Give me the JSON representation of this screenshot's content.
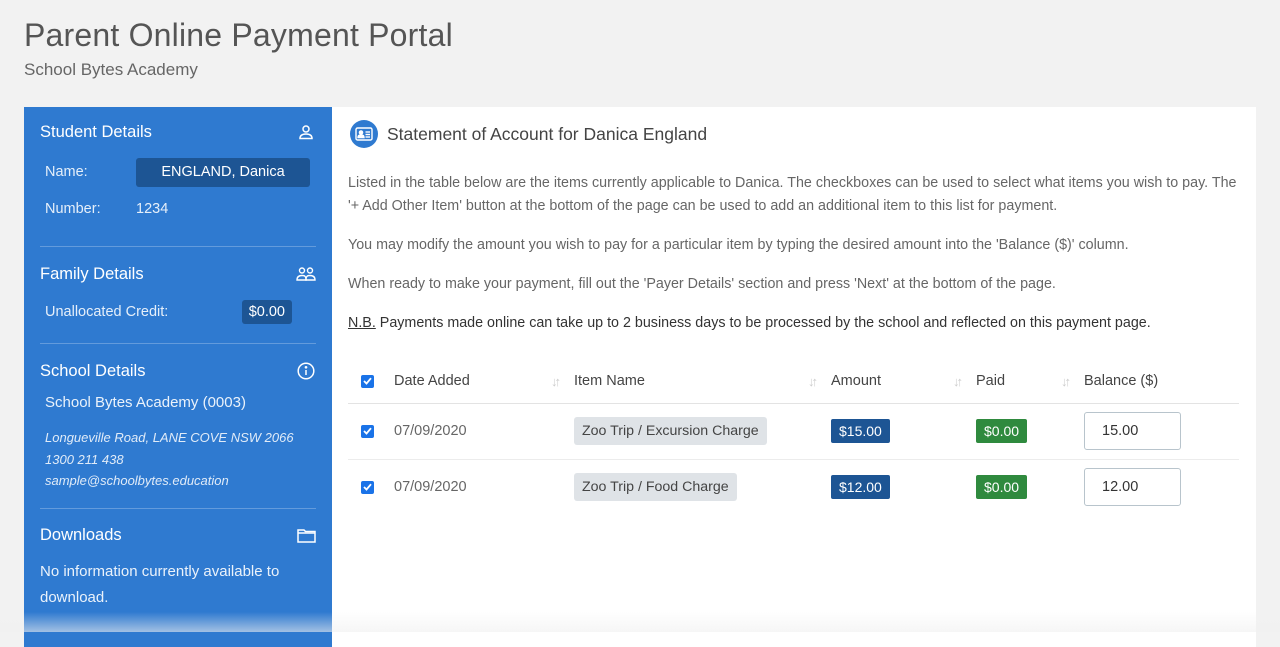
{
  "header": {
    "title": "Parent Online Payment Portal",
    "subtitle": "School Bytes Academy"
  },
  "sidebar": {
    "student": {
      "title": "Student Details",
      "icon": "user-icon",
      "name_label": "Name:",
      "name_value": "ENGLAND, Danica",
      "number_label": "Number:",
      "number_value": "1234"
    },
    "family": {
      "title": "Family Details",
      "icon": "users-icon",
      "credit_label": "Unallocated Credit:",
      "credit_value": "$0.00"
    },
    "school": {
      "title": "School Details",
      "icon": "info-icon",
      "name": "School Bytes Academy (0003)",
      "address": "Longueville Road, LANE COVE NSW 2066",
      "phone": "1300 211 438",
      "email": "sample@schoolbytes.education"
    },
    "downloads": {
      "title": "Downloads",
      "icon": "folder-icon",
      "text": "No information currently available to download."
    }
  },
  "main": {
    "title": "Statement of Account for Danica England",
    "icon": "id-card-icon",
    "intro": "Listed in the table below are the items currently applicable to Danica. The checkboxes can be used to select what items you wish to pay. The '+ Add Other Item' button at the bottom of the page can be used to add an additional item to this list for payment.",
    "modify": "You may modify the amount you wish to pay for a particular item by typing the desired amount into the 'Balance ($)' column.",
    "ready": "When ready to make your payment, fill out the 'Payer Details' section and press 'Next' at the bottom of the page.",
    "nb_label": "N.B.",
    "nb_text": " Payments made online can take up to 2 business days to be processed by the school and reflected on this payment page.",
    "table": {
      "select_all_checked": true,
      "columns": [
        "Date Added",
        "Item Name",
        "Amount",
        "Paid",
        "Balance ($)"
      ],
      "rows": [
        {
          "checked": true,
          "date": "07/09/2020",
          "item": "Zoo Trip / Excursion Charge",
          "amount": "$15.00",
          "paid": "$0.00",
          "balance": "15.00"
        },
        {
          "checked": true,
          "date": "07/09/2020",
          "item": "Zoo Trip / Food Charge",
          "amount": "$12.00",
          "paid": "$0.00",
          "balance": "12.00"
        }
      ]
    }
  },
  "colors": {
    "sidebar_bg": "#2f7ad0",
    "pill_dark_blue": "#1d5594",
    "paid_green": "#2f8a3e",
    "checkbox_blue": "#1a73e8"
  }
}
